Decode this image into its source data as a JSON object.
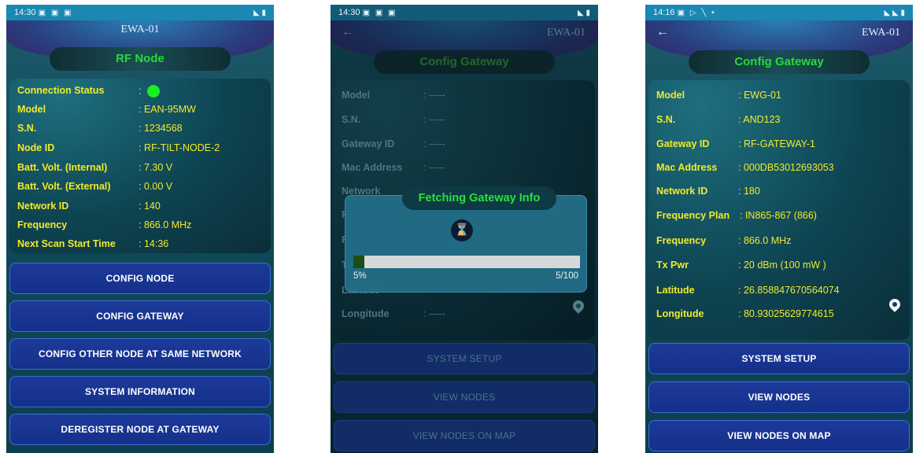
{
  "screen1": {
    "status_time": "14:30",
    "title": "EWA-01",
    "pill": "RF Node",
    "rows": [
      {
        "label": "Connection Status",
        "value": ":"
      },
      {
        "label": "Model",
        "value": ": EAN-95MW"
      },
      {
        "label": "S.N.",
        "value": ": 1234568"
      },
      {
        "label": "Node ID",
        "value": ": RF-TILT-NODE-2"
      },
      {
        "label": "Batt. Volt. (Internal)",
        "value": ": 7.30 V"
      },
      {
        "label": "Batt. Volt. (External)",
        "value": ": 0.00 V"
      },
      {
        "label": "Network ID",
        "value": ": 140"
      },
      {
        "label": "Frequency",
        "value": ": 866.0 MHz"
      },
      {
        "label": "Next Scan Start Time",
        "value": ": 14:36"
      }
    ],
    "buttons": [
      "CONFIG NODE",
      "CONFIG GATEWAY",
      "CONFIG OTHER NODE AT SAME NETWORK",
      "SYSTEM INFORMATION",
      "DEREGISTER NODE AT GATEWAY"
    ]
  },
  "screen2": {
    "status_time": "14:30",
    "title": "EWA-01",
    "pill": "Config Gateway",
    "rows": [
      {
        "label": "Model",
        "value": ": -----"
      },
      {
        "label": "S.N.",
        "value": ": -----"
      },
      {
        "label": "Gateway ID",
        "value": ": -----"
      },
      {
        "label": "Mac Address",
        "value": ": -----"
      },
      {
        "label": "Network",
        "value": ""
      },
      {
        "label": "F",
        "value": ""
      },
      {
        "label": "F",
        "value": ""
      },
      {
        "label": "T",
        "value": ""
      },
      {
        "label": "Latitude",
        "value": ""
      },
      {
        "label": "Longitude",
        "value": ": -----"
      }
    ],
    "dialog": {
      "title": "Fetching Gateway Info",
      "progress_percent": 5,
      "progress_text": "5%",
      "progress_count": "5/100"
    },
    "buttons": [
      "SYSTEM SETUP",
      "VIEW NODES",
      "VIEW NODES ON MAP"
    ]
  },
  "screen3": {
    "status_time": "14:16",
    "title": "EWA-01",
    "pill": "Config Gateway",
    "rows": [
      {
        "label": "Model",
        "value": ": EWG-01"
      },
      {
        "label": "S.N.",
        "value": ": AND123"
      },
      {
        "label": "Gateway ID",
        "value": ": RF-GATEWAY-1"
      },
      {
        "label": "Mac Address",
        "value": ": 000DB53012693053"
      },
      {
        "label": "Network ID",
        "value": ": 180"
      },
      {
        "label": "Frequency Plan",
        "value": ": IN865-867 (866)"
      },
      {
        "label": "Frequency",
        "value": ": 866.0 MHz"
      },
      {
        "label": "Tx Pwr",
        "value": ": 20 dBm (100 mW )"
      },
      {
        "label": "Latitude",
        "value": ": 26.858847670564074"
      },
      {
        "label": "Longitude",
        "value": ": 80.93025629774615"
      }
    ],
    "buttons": [
      "SYSTEM SETUP",
      "VIEW NODES",
      "VIEW NODES ON MAP"
    ]
  },
  "icons": {
    "back": "back-arrow-icon",
    "location": "location-pin-icon",
    "hourglass": "hourglass-icon",
    "connection": "status-dot-icon"
  },
  "colors": {
    "label_yellow": "#f2ea2a",
    "accent_green": "#22dd33",
    "button_blue": "#14308a",
    "status_bar": "#1b87b3"
  }
}
